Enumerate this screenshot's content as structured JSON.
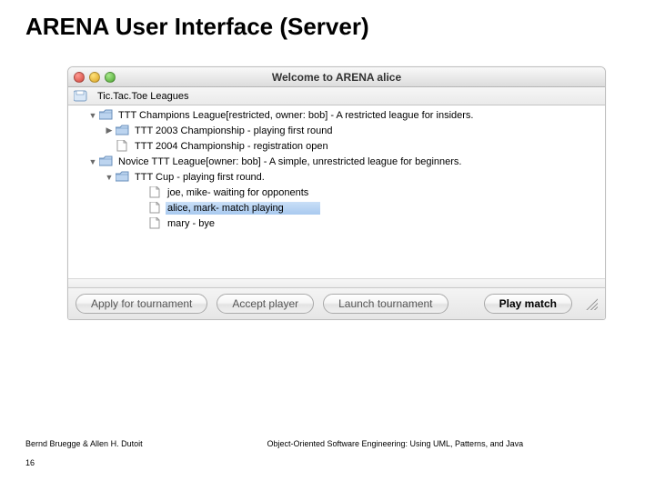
{
  "slide": {
    "title": "ARENA User Interface (Server)"
  },
  "window": {
    "title": "Welcome to ARENA alice"
  },
  "root": {
    "label": "Tic.Tac.Toe Leagues"
  },
  "tree": [
    {
      "id": "champ",
      "indent": 2,
      "disclosure": "down",
      "icon": "folder",
      "label": "TTT Champions League[restricted, owner: bob] - A restricted league for insiders."
    },
    {
      "id": "2003",
      "indent": 3,
      "disclosure": "right",
      "icon": "folder",
      "label": "TTT 2003 Championship - playing first round"
    },
    {
      "id": "2004",
      "indent": 3,
      "disclosure": "",
      "icon": "file",
      "label": "TTT 2004 Championship - registration open"
    },
    {
      "id": "novice",
      "indent": 2,
      "disclosure": "down",
      "icon": "folder",
      "label": "Novice TTT League[owner: bob] - A simple, unrestricted league for beginners."
    },
    {
      "id": "cup",
      "indent": 3,
      "disclosure": "down",
      "icon": "folder",
      "label": "TTT Cup - playing first round."
    },
    {
      "id": "joemike",
      "indent": 5,
      "disclosure": "",
      "icon": "file",
      "label": "joe, mike- waiting for opponents"
    },
    {
      "id": "alice",
      "indent": 5,
      "disclosure": "",
      "icon": "file",
      "label": "alice, mark- match playing",
      "selected": true
    },
    {
      "id": "mary",
      "indent": 5,
      "disclosure": "",
      "icon": "file",
      "label": "mary - bye"
    }
  ],
  "buttons": {
    "apply": "Apply for tournament",
    "accept": "Accept player",
    "launch": "Launch tournament",
    "play": "Play match"
  },
  "footer": {
    "author": "Bernd Bruegge & Allen H. Dutoit",
    "page": "16",
    "book": "Object-Oriented Software Engineering: Using UML, Patterns, and Java"
  }
}
